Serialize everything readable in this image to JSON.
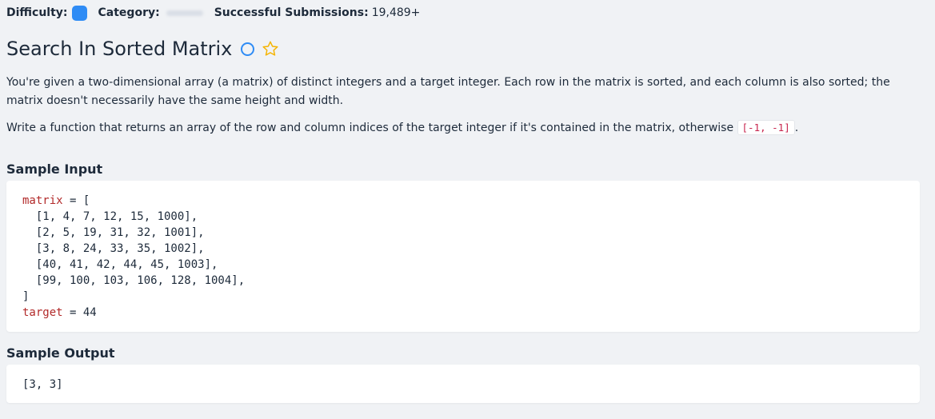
{
  "meta": {
    "difficulty_label": "Difficulty:",
    "category_label": "Category:",
    "submissions_label": "Successful Submissions:",
    "submissions_value": "19,489+",
    "difficulty_color": "#2f8cf5"
  },
  "problem": {
    "title": "Search In Sorted Matrix",
    "status_icon": "circle-outline-icon",
    "favorite_icon": "star-outline-icon",
    "paragraph1": "You're given a two-dimensional array (a matrix) of distinct integers and a target integer. Each row in the matrix is sorted, and each column is also sorted; the matrix doesn't necessarily have the same height and width.",
    "paragraph2_text": "Write a function that returns an array of the row and column indices of the target integer if it's contained in the matrix, otherwise",
    "paragraph2_code": "[-1, -1]",
    "paragraph2_end": "."
  },
  "sample_input": {
    "title": "Sample Input",
    "matrix_var": "matrix",
    "matrix_open": " = [",
    "rows": [
      "  [1, 4, 7, 12, 15, 1000],",
      "  [2, 5, 19, 31, 32, 1001],",
      "  [3, 8, 24, 33, 35, 1002],",
      "  [40, 41, 42, 44, 45, 1003],",
      "  [99, 100, 103, 106, 128, 1004],"
    ],
    "matrix_close": "]",
    "target_var": "target",
    "target_rest": " = 44"
  },
  "sample_output": {
    "title": "Sample Output",
    "value": "[3, 3]"
  },
  "colors": {
    "accent": "#2f8cf5",
    "star": "#f5b400",
    "code_variable": "#b22a2a",
    "inline_code": "#c7254e",
    "background": "#f0f2f5"
  }
}
